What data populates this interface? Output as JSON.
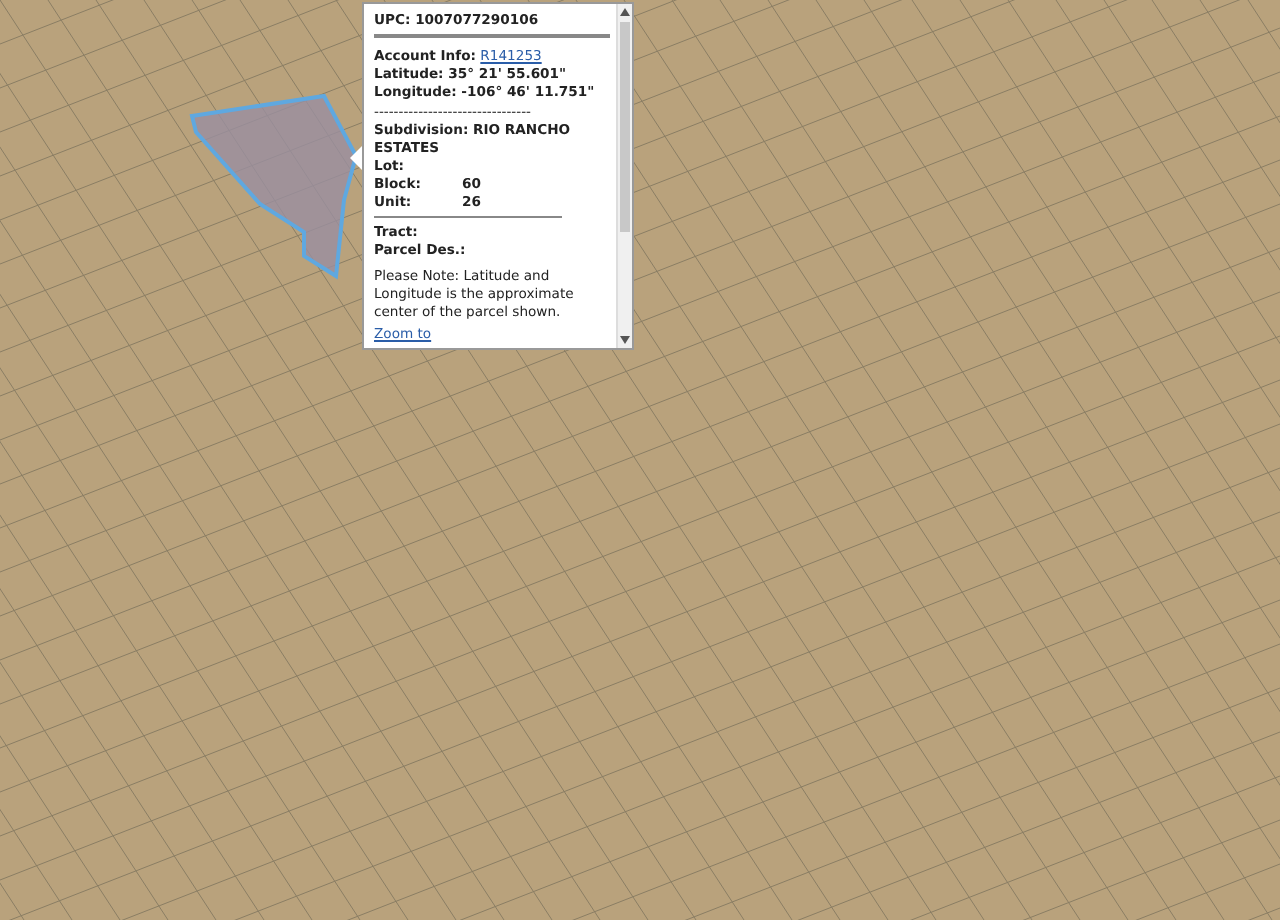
{
  "popup": {
    "upc": "UPC: 1007077290106",
    "account": {
      "label": "Account Info:",
      "link": "R141253"
    },
    "latitude": "Latitude: 35° 21' 55.601\"",
    "longitude": "Longitude: -106° 46' 11.751\"",
    "separator": "--------------------------------",
    "fields": [
      {
        "label": "Subdivision: RIO RANCHO ESTATES"
      },
      {
        "label": "Lot:"
      },
      {
        "label": "Block:",
        "value": "60"
      },
      {
        "label": "Unit:",
        "value": "26"
      }
    ],
    "fields_2": [
      {
        "label": "Tract:"
      },
      {
        "label": "Parcel Des.:"
      }
    ],
    "note": "Please Note: Latitude and Longitude is the approximate center of the parcel shown.",
    "zoom_link": "Zoom to"
  }
}
